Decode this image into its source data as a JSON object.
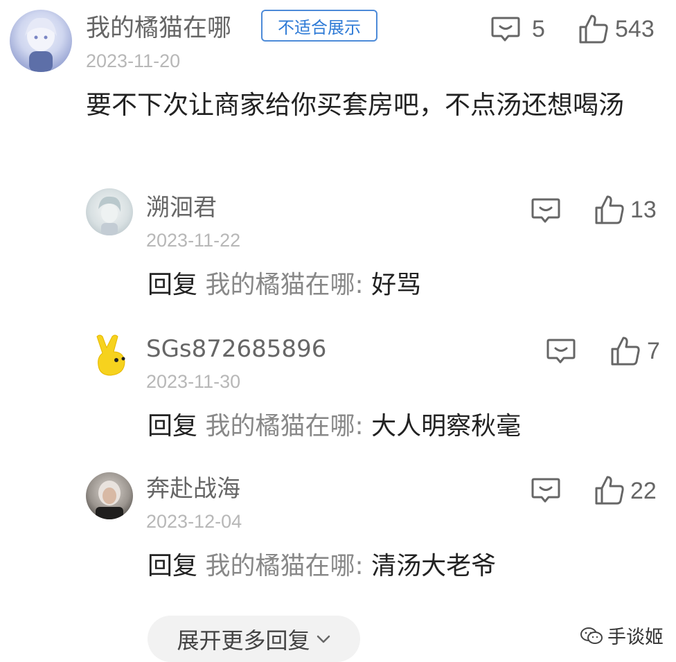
{
  "comment": {
    "author": "我的橘猫在哪",
    "badge": "不适合展示",
    "date": "2023-11-20",
    "reply_count": "5",
    "like_count": "543",
    "text": "要不下次让商家给你买套房吧，不点汤还想喝汤"
  },
  "replies": [
    {
      "author": "溯洄君",
      "date": "2023-11-22",
      "like_count": "13",
      "prefix": "回复",
      "to": "我的橘猫在哪:",
      "text": "好骂"
    },
    {
      "author": "SGs872685896",
      "date": "2023-11-30",
      "like_count": "7",
      "prefix": "回复",
      "to": "我的橘猫在哪:",
      "text": "大人明察秋毫"
    },
    {
      "author": "奔赴战海",
      "date": "2023-12-04",
      "like_count": "22",
      "prefix": "回复",
      "to": "我的橘猫在哪:",
      "text": "清汤大老爷"
    }
  ],
  "expand_label": "展开更多回复",
  "watermark": "手谈姬",
  "colors": {
    "badge_border": "#4c8ad8",
    "badge_text": "#2f7bd6",
    "meta_gray": "#b7b7b7",
    "name_gray": "#666666"
  }
}
